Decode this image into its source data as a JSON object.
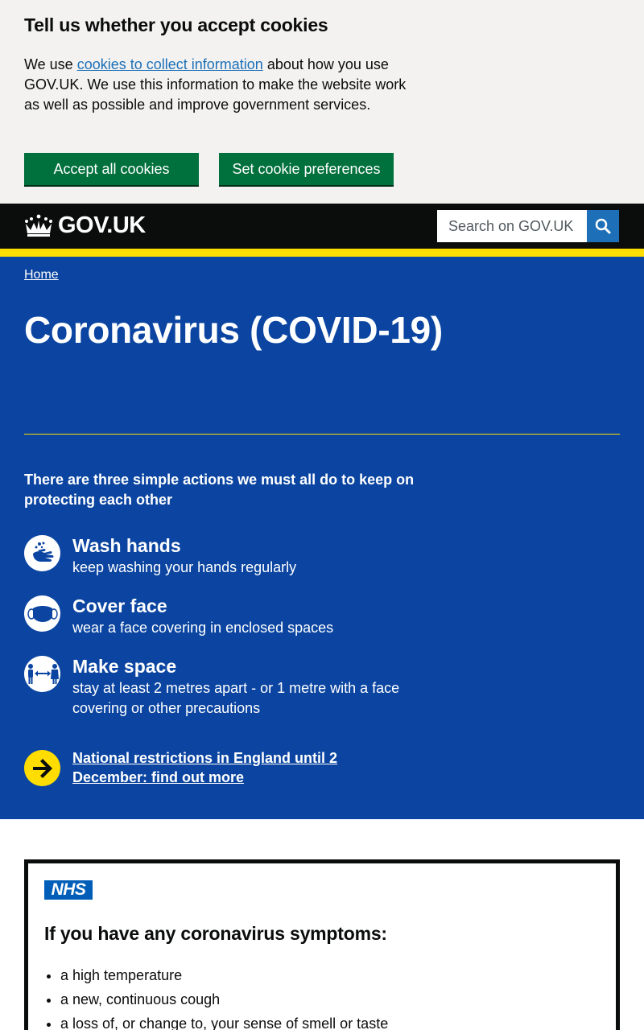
{
  "cookie_banner": {
    "title": "Tell us whether you accept cookies",
    "text_before": "We use ",
    "link_text": "cookies to collect information",
    "text_after": " about how you use GOV.UK. We use this information to make the website work as well as possible and improve government services.",
    "accept_label": "Accept all cookies",
    "preferences_label": "Set cookie preferences"
  },
  "header": {
    "logo_text": "GOV.UK",
    "search_placeholder": "Search on GOV.UK"
  },
  "breadcrumb": {
    "home": "Home"
  },
  "hero": {
    "title": "Coronavirus (COVID-19)",
    "actions_intro": "There are three simple actions we must all do to keep on protecting each other",
    "actions": [
      {
        "icon": "wash-hands-icon",
        "title": "Wash hands",
        "desc": "keep washing your hands regularly"
      },
      {
        "icon": "face-mask-icon",
        "title": "Cover face",
        "desc": "wear a face covering in enclosed spaces"
      },
      {
        "icon": "make-space-icon",
        "title": "Make space",
        "desc": "stay at least 2 metres apart - or 1 metre with a face covering or other precautions"
      }
    ],
    "restrictions_link": "National restrictions in England until 2 December: find out more"
  },
  "nhs": {
    "logo": "NHS",
    "heading": "If you have any coronavirus symptoms:",
    "symptoms": [
      "a high temperature",
      "a new, continuous cough",
      "a loss of, or change to, your sense of smell or taste"
    ]
  },
  "colors": {
    "hero_blue": "#0b45a1",
    "header_black": "#0b0c0c",
    "accent_yellow": "#ffdd00",
    "button_green": "#00703c",
    "link_blue": "#1d70b8",
    "nhs_blue": "#005eb8"
  }
}
